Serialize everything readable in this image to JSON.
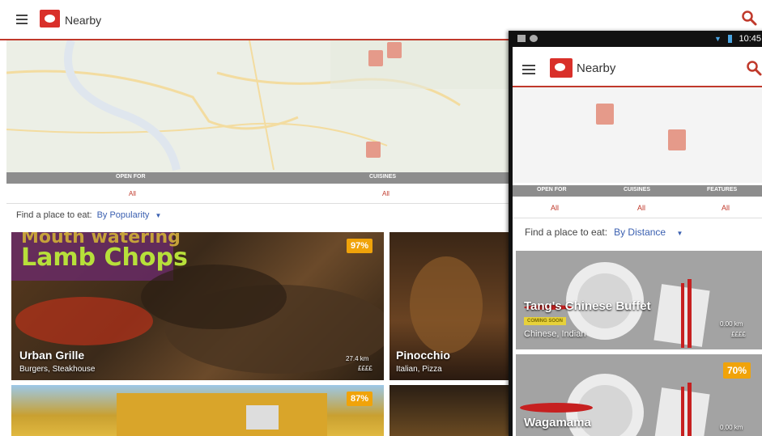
{
  "tablet": {
    "app_title": "Nearby",
    "filters": [
      {
        "label": "OPEN FOR",
        "value": "All"
      },
      {
        "label": "CUISINES",
        "value": "All"
      }
    ],
    "find_label": "Find a place to eat:",
    "sort_value": "By Popularity",
    "cards": [
      {
        "headline1": "Mouth watering",
        "headline2": "Lamb Chops",
        "name": "Urban Grille",
        "categories": "Burgers, Steakhouse",
        "distance": "27.4 km",
        "price": "££££",
        "rating": "97%"
      },
      {
        "name": "Pinocchio",
        "categories": "Italian, Pizza"
      },
      {
        "rating": "87%"
      }
    ]
  },
  "phone": {
    "status_time": "10:45",
    "app_title": "Nearby",
    "filters": [
      {
        "label": "OPEN FOR",
        "value": "All"
      },
      {
        "label": "CUISINES",
        "value": "All"
      },
      {
        "label": "FEATURES",
        "value": "All"
      }
    ],
    "find_label": "Find a place to eat:",
    "sort_value": "By Distance",
    "cards": [
      {
        "name": "Tang's Chinese Buffet",
        "badge": "COMING SOON",
        "categories": "Chinese, Indian",
        "distance": "0.00 km",
        "price": "££££"
      },
      {
        "name": "Wagamama",
        "distance": "0.00 km",
        "rating": "70%"
      }
    ]
  },
  "colors": {
    "brand": "#d9302a",
    "accent_blue": "#3a5fb0",
    "rating_badge": "#f0a30a"
  }
}
